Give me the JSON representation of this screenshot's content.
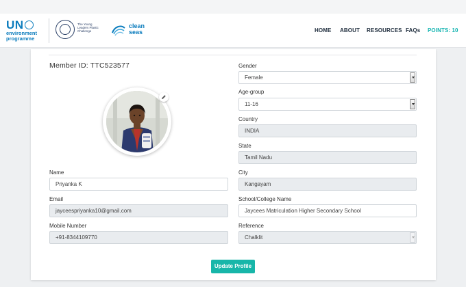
{
  "header": {
    "un_logo": {
      "un": "UN",
      "line1": "environment",
      "line2": "programme"
    },
    "ylpc_logo": {
      "line1": "The Young",
      "line2": "Leaders Plastic",
      "line3": "Challenge"
    },
    "cleanseas_logo": {
      "line1": "clean",
      "line2": "seas"
    },
    "nav": {
      "home": "HOME",
      "about": "ABOUT",
      "resources": "RESOURCES",
      "faqs": "FAQs",
      "points": "POINTS: 10"
    }
  },
  "profile": {
    "member_id": "Member ID: TTC523577",
    "name_label": "Name",
    "name_value": "Priyanka K",
    "email_label": "Email",
    "email_value": "jayceespriyanka10@gmail.com",
    "mobile_label": "Mobile Number",
    "mobile_value": "+91-8344109770",
    "gender_label": "Gender",
    "gender_value": "Female",
    "age_label": "Age-group",
    "age_value": "11-16",
    "country_label": "Country",
    "country_value": "INDIA",
    "state_label": "State",
    "state_value": "Tamil Nadu",
    "city_label": "City",
    "city_value": "Kangayam",
    "school_label": "School/College Name",
    "school_value": "Jaycees Matriculation Higher Secondary School",
    "reference_label": "Reference",
    "reference_value": "Chalklit",
    "update_button": "Update Profile"
  },
  "colors": {
    "accent": "#17b6a9",
    "brand": "#0b7cbd",
    "nav_points": "#11b3b0"
  }
}
